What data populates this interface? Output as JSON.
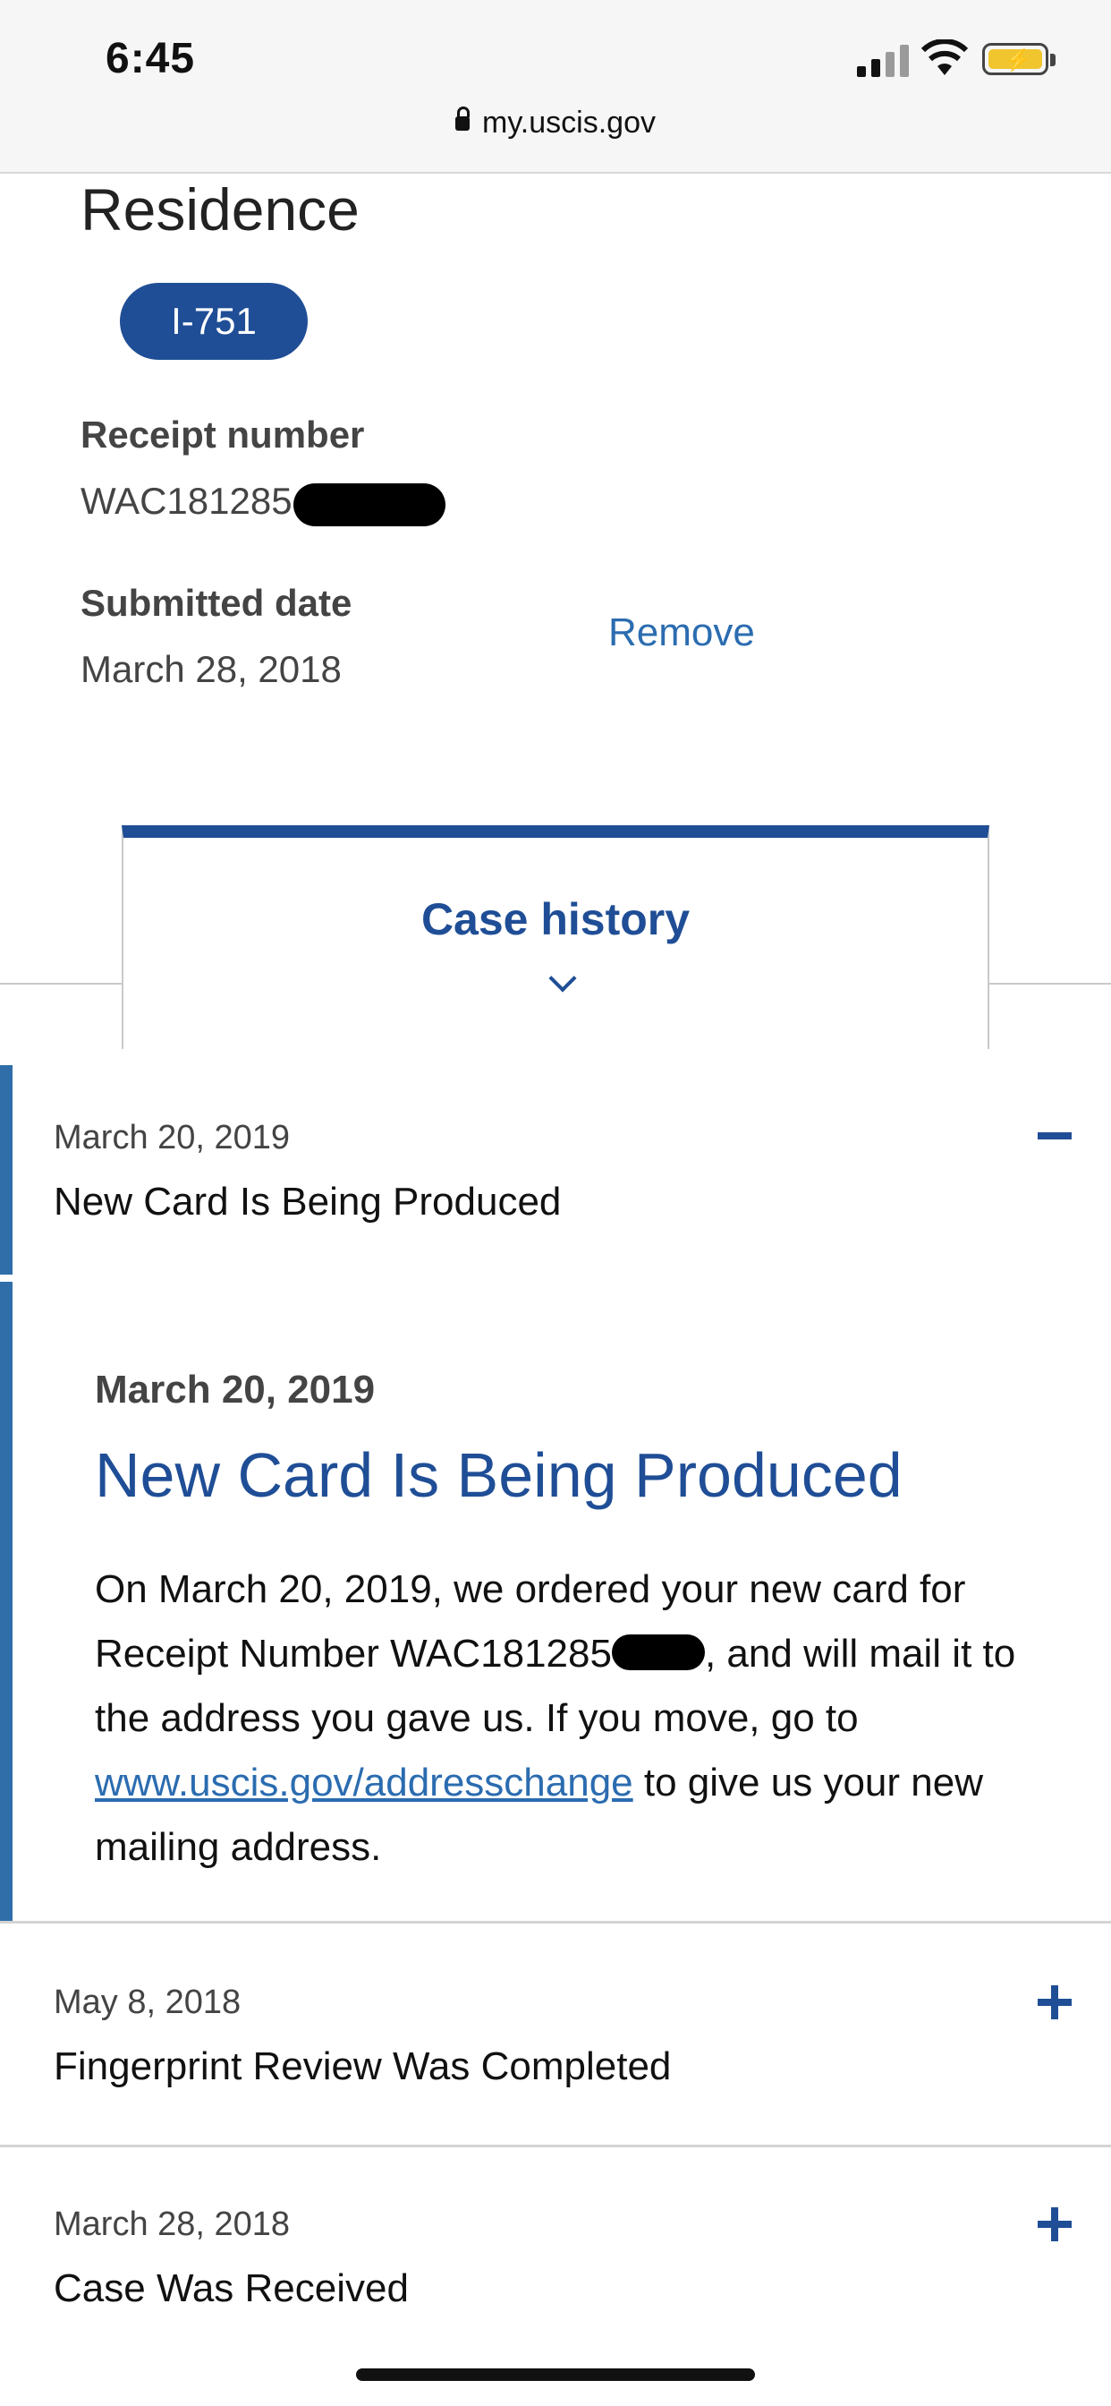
{
  "status_bar": {
    "time": "6:45",
    "url": "my.uscis.gov"
  },
  "case": {
    "heading": "Residence",
    "form_type": "I-751",
    "receipt_label": "Receipt number",
    "receipt_value": "WAC181285",
    "submitted_label": "Submitted date",
    "submitted_value": "March 28, 2018",
    "remove_label": "Remove"
  },
  "history_tab": {
    "label": "Case history"
  },
  "history": [
    {
      "date": "March 20, 2019",
      "title": "New Card Is Being Produced",
      "expanded": true
    },
    {
      "date": "May 8, 2018",
      "title": "Fingerprint Review Was Completed",
      "expanded": false
    },
    {
      "date": "March 28, 2018",
      "title": "Case Was Received",
      "expanded": false
    }
  ],
  "detail": {
    "date": "March 20, 2019",
    "title": "New Card Is Being Produced",
    "body_part1": "On March 20, 2019, we ordered your new card for Receipt Number WAC181285",
    "body_part2": ", and will mail it to the address you gave us. If you move, go to ",
    "link_text": "www.uscis.gov/addresschange",
    "body_part3": " to give us your new mailing address."
  },
  "colors": {
    "accent": "#1f4e96",
    "link": "#2b6cb0"
  }
}
